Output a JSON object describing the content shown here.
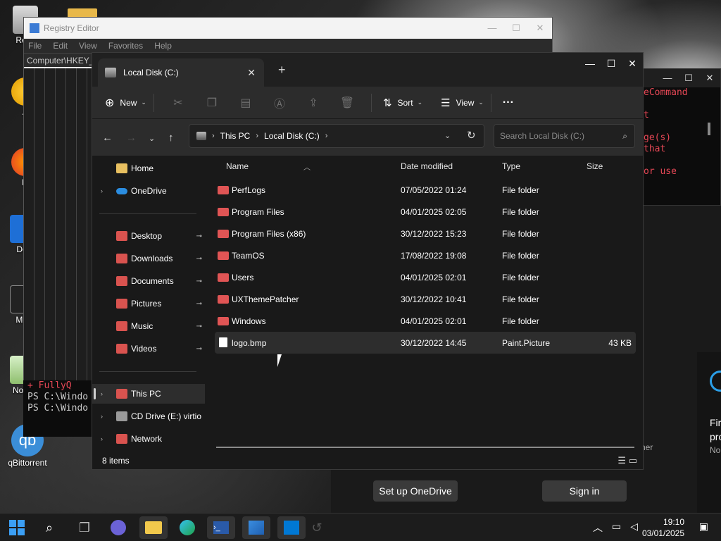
{
  "desktop": {
    "icons": [
      {
        "label": "Recy",
        "icon": "recycle-bin-icon"
      },
      {
        "label": "A",
        "icon": "app-icon"
      },
      {
        "label": "Fi",
        "icon": "firefox-icon"
      },
      {
        "label": "Dov",
        "icon": "download-icon"
      },
      {
        "label": "Mob",
        "icon": "terminal-icon"
      },
      {
        "label": "Notep",
        "icon": "notepad-icon"
      },
      {
        "label": "qBittorrent",
        "icon": "qbittorrent-icon"
      }
    ],
    "qb_glyph": "qb"
  },
  "regedit": {
    "title": "Registry Editor",
    "menu": [
      "File",
      "Edit",
      "View",
      "Favorites",
      "Help"
    ],
    "address": "Computer\\HKEY_"
  },
  "powershell": {
    "lines": [
      "eCommand",
      "",
      "t",
      "",
      "ge(s)",
      "that",
      "",
      "or use"
    ],
    "lower_lines": [
      "+ FullyQ",
      "PS C:\\Windo",
      "PS C:\\Windo"
    ]
  },
  "right_panel": {
    "partial_texts": [
      "Fir",
      "pro",
      "No",
      "her"
    ],
    "setup_onedrive": "Set up OneDrive",
    "sign_in": "Sign in"
  },
  "explorer": {
    "tab_title": "Local Disk (C:)",
    "toolbar": {
      "new_label": "New",
      "sort_label": "Sort",
      "view_label": "View",
      "more_label": "···"
    },
    "breadcrumb": [
      "This PC",
      "Local Disk (C:)"
    ],
    "search_placeholder": "Search Local Disk (C:)",
    "sidebar": {
      "home": "Home",
      "onedrive": "OneDrive",
      "quick": [
        {
          "label": "Desktop",
          "color": "#d9534f"
        },
        {
          "label": "Downloads",
          "color": "#d9534f"
        },
        {
          "label": "Documents",
          "color": "#d9534f"
        },
        {
          "label": "Pictures",
          "color": "#d9534f"
        },
        {
          "label": "Music",
          "color": "#d9534f"
        },
        {
          "label": "Videos",
          "color": "#d9534f"
        }
      ],
      "thispc": "This PC",
      "cddrive": "CD Drive (E:) virtio-",
      "network": "Network"
    },
    "columns": {
      "name": "Name",
      "date": "Date modified",
      "type": "Type",
      "size": "Size"
    },
    "files": [
      {
        "name": "PerfLogs",
        "date": "07/05/2022 01:24",
        "type": "File folder",
        "size": ""
      },
      {
        "name": "Program Files",
        "date": "04/01/2025 02:05",
        "type": "File folder",
        "size": ""
      },
      {
        "name": "Program Files (x86)",
        "date": "30/12/2022 15:23",
        "type": "File folder",
        "size": ""
      },
      {
        "name": "TeamOS",
        "date": "17/08/2022 19:08",
        "type": "File folder",
        "size": ""
      },
      {
        "name": "Users",
        "date": "04/01/2025 02:01",
        "type": "File folder",
        "size": ""
      },
      {
        "name": "UXThemePatcher",
        "date": "30/12/2022 10:41",
        "type": "File folder",
        "size": ""
      },
      {
        "name": "Windows",
        "date": "04/01/2025 02:01",
        "type": "File folder",
        "size": ""
      },
      {
        "name": "logo.bmp",
        "date": "30/12/2022 14:45",
        "type": "Paint.Picture",
        "size": "43 KB"
      }
    ],
    "status": "8 items",
    "folder_color": "#e05555"
  },
  "taskbar": {
    "time": "19:10",
    "date": "03/01/2025",
    "accent": "#0078d4"
  }
}
